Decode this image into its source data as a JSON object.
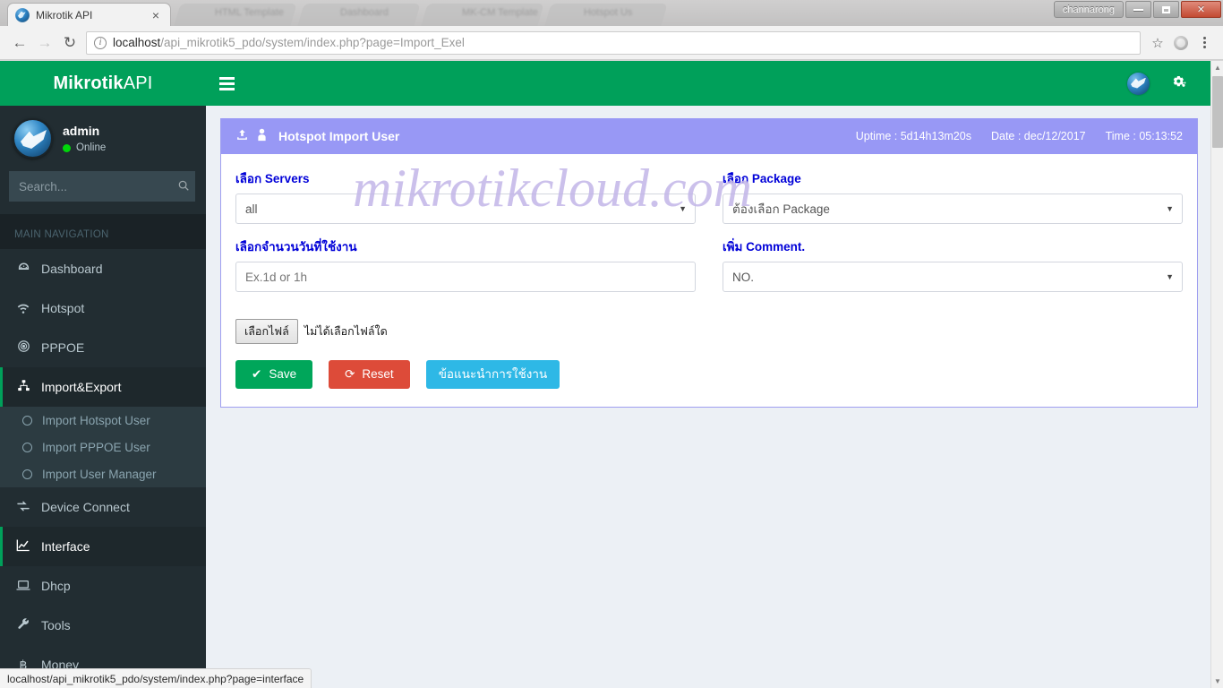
{
  "browser": {
    "tab": {
      "title": "Mikrotik API",
      "favicon": "mikrotik-logo-icon",
      "close": "×"
    },
    "ghost_tabs": [
      "HTML Template",
      "Dashboard",
      "MK-CM Template",
      "Hotspot Us"
    ],
    "window": {
      "user_button": "channarong",
      "minimize": "minimize-icon",
      "restore": "restore-icon",
      "close": "✕"
    },
    "nav": {
      "back": "←",
      "forward": "→",
      "reload": "↻"
    },
    "omnibox": {
      "info_icon": "i",
      "host": "localhost",
      "path": "/api_mikrotik5_pdo/system/index.php?page=Import_Exel",
      "full_url": "localhost/api_mikrotik5_pdo/system/index.php?page=Import_Exel"
    },
    "toolbar_icons": {
      "bookmark": "☆",
      "profile": "account-avatar-icon",
      "menu": "kebab-menu-icon"
    },
    "status_bar_link": "localhost/api_mikrotik5_pdo/system/index.php?page=interface"
  },
  "app": {
    "brand": {
      "bold": "Mikrotik",
      "light": "API"
    },
    "navbar": {
      "toggle": "hamburger-menu-icon",
      "logo": "mikrotik-ball-icon",
      "settings": "⚛"
    }
  },
  "sidebar": {
    "user": {
      "name": "admin",
      "status": "Online",
      "avatar": "mikrotik-avatar-icon"
    },
    "search": {
      "placeholder": "Search...",
      "value": "",
      "icon": "search-icon"
    },
    "nav_header": "MAIN NAVIGATION",
    "items": [
      {
        "label": "Dashboard",
        "icon": "⎈",
        "active": false
      },
      {
        "label": "Hotspot",
        "icon": "ᵜ",
        "active": false
      },
      {
        "label": "PPPOE",
        "icon": "◎",
        "active": false
      },
      {
        "label": "Import&Export",
        "icon": "⑂",
        "active": true
      },
      {
        "label": "Device Connect",
        "icon": "⤨",
        "active": false
      },
      {
        "label": "Interface",
        "icon": "↗",
        "active": true
      },
      {
        "label": "Dhcp",
        "icon": "⎕",
        "active": false
      },
      {
        "label": "Tools",
        "icon": "⚒",
        "active": false
      },
      {
        "label": "Money",
        "icon": "฿",
        "active": false
      }
    ],
    "submenu": [
      {
        "label": "Import Hotspot User"
      },
      {
        "label": "Import PPPOE User"
      },
      {
        "label": "Import User Manager"
      }
    ]
  },
  "box": {
    "header": {
      "upload_icon": "upload-icon",
      "user_icon": "user-icon",
      "title": "Hotspot Import User",
      "uptime": "Uptime : 5d14h13m20s",
      "date": "Date : dec/12/2017",
      "time": "Time : 05:13:52"
    },
    "fields": {
      "servers": {
        "label": "เลือก Servers",
        "value": "all"
      },
      "package": {
        "label": "เลือก Package",
        "value": "ต้องเลือก Package"
      },
      "days": {
        "label": "เลือกจำนวนวันที่ใช้งาน",
        "value": "",
        "placeholder": "Ex.1d or 1h"
      },
      "comment": {
        "label": "เพิ่ม Comment.",
        "value": "NO."
      }
    },
    "file_input": {
      "button": "เลือกไฟล์",
      "name": "ไม่ได้เลือกไฟล์ใด"
    },
    "buttons": {
      "save": {
        "label": "Save",
        "icon": "✔"
      },
      "reset": {
        "label": "Reset",
        "icon": "⟳"
      },
      "help": {
        "label": "ข้อแนะนำการใช้งาน"
      }
    },
    "watermark": "mikrotikcloud.com"
  },
  "colors": {
    "brand_green": "#00a05a",
    "sidebar_bg": "#222d32",
    "box_header": "#9898f5",
    "label_blue": "#0000d8",
    "save_green": "#00a65a",
    "reset_red": "#dd4b39",
    "info_blue": "#2eb8e6",
    "page_bg": "#ecf0f5"
  }
}
